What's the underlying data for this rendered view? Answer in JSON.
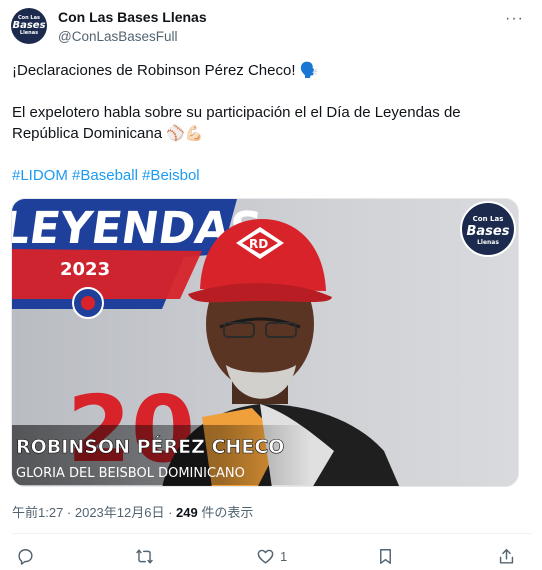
{
  "author": {
    "display_name": "Con Las Bases Llenas",
    "handle": "@ConLasBasesFull",
    "avatar_text": [
      "Con Las",
      "Bases",
      "Llenas"
    ]
  },
  "more_label": "···",
  "tweet": {
    "line1": "¡Declaraciones de Robinson Pérez Checo! 🗣️",
    "line2": "El expelotero habla sobre su participación el el Día de Leyendas de",
    "line3": "República Dominicana ⚾💪🏻",
    "hashtags": [
      "#LIDOM",
      "#Baseball",
      "#Beisbol"
    ]
  },
  "media": {
    "banner_text": "LEYENDAS",
    "banner_year": "2023",
    "cap_logo": "RD",
    "jersey_number": "20",
    "watermark": [
      "Con Las",
      "Bases",
      "Llenas"
    ],
    "caption_name": "ROBINSON PÉREZ CHECO",
    "caption_title": "GLORIA DEL BEISBOL DOMINICANO"
  },
  "meta": {
    "timestamp": "午前1:27 · 2023年12月6日 · ",
    "views": "249",
    "views_suffix": " 件の表示"
  },
  "actions": {
    "reply_icon": "reply-icon",
    "retweet_icon": "retweet-icon",
    "like_icon": "heart-icon",
    "like_count": "1",
    "bookmark_icon": "bookmark-icon",
    "share_icon": "share-icon"
  },
  "colors": {
    "link": "#1d9bf0",
    "muted": "#536471",
    "text": "#0f1419",
    "banner_blue": "#1e3f9a",
    "cap_red": "#d8232a"
  }
}
